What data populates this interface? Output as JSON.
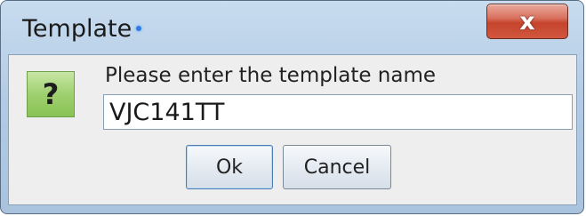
{
  "window": {
    "title": "Template",
    "close_glyph": "x",
    "close_icon": "close-icon"
  },
  "dialog": {
    "icon": "question-icon",
    "icon_glyph": "?",
    "prompt": "Please enter the template name",
    "input_value": "VJC141TT",
    "ok_label": "Ok",
    "cancel_label": "Cancel"
  }
}
